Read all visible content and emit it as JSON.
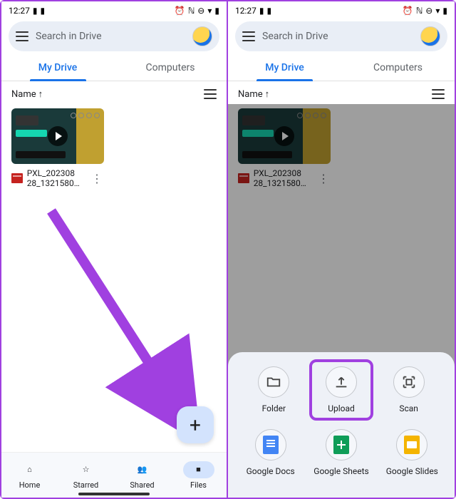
{
  "status": {
    "time": "12:27"
  },
  "search": {
    "placeholder": "Search in Drive"
  },
  "tabs": {
    "my_drive": "My Drive",
    "computers": "Computers"
  },
  "sort": {
    "label": "Name",
    "arrow": "↑"
  },
  "file": {
    "name_line1": "PXL_202308",
    "name_line2": "28_1321580…"
  },
  "fab": {
    "glyph": "+"
  },
  "nav": {
    "home": "Home",
    "starred": "Starred",
    "shared": "Shared",
    "files": "Files"
  },
  "sheet": {
    "folder": "Folder",
    "upload": "Upload",
    "scan": "Scan",
    "docs": "Google Docs",
    "sheets": "Google Sheets",
    "slides": "Google Slides"
  }
}
